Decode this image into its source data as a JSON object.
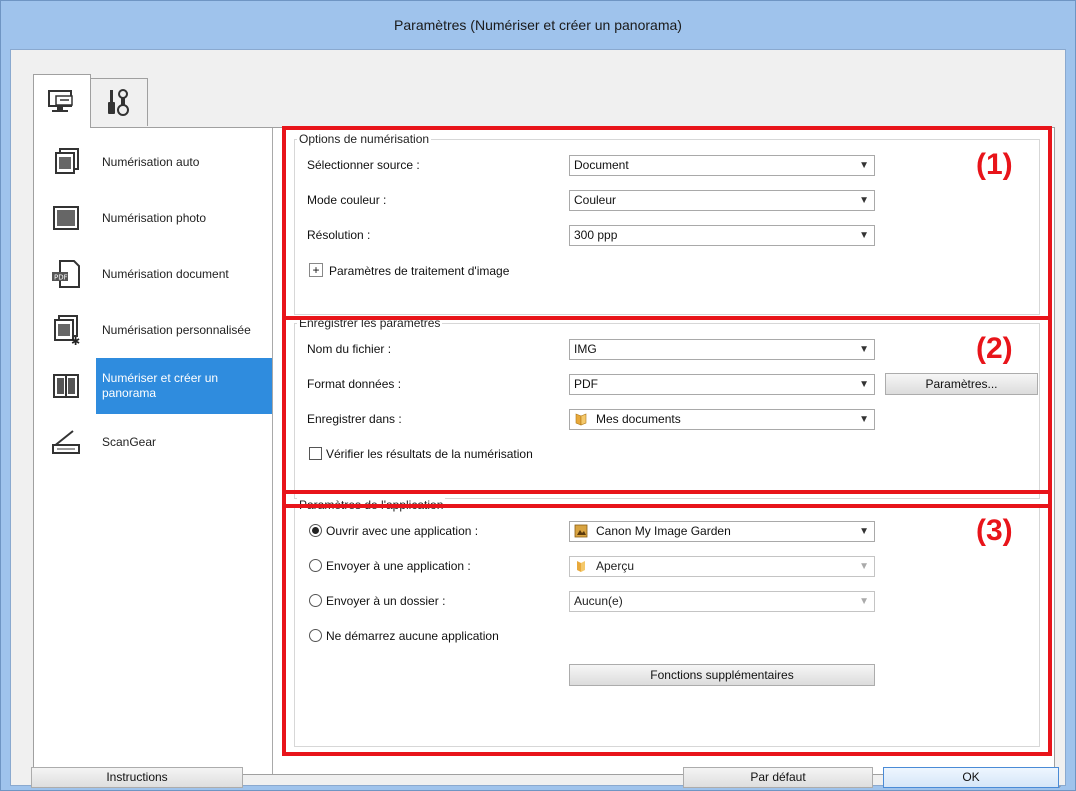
{
  "window": {
    "title": "Paramètres (Numériser et créer un panorama)"
  },
  "tabs": [
    {
      "icon": "scan-computer-icon",
      "selected": true
    },
    {
      "icon": "tools-icon",
      "selected": false
    }
  ],
  "sidebar": {
    "items": [
      {
        "label": "Numérisation auto",
        "icon": "auto-scan-icon"
      },
      {
        "label": "Numérisation photo",
        "icon": "photo-scan-icon"
      },
      {
        "label": "Numérisation document",
        "icon": "document-scan-icon"
      },
      {
        "label": "Numérisation personnalisée",
        "icon": "custom-scan-icon"
      },
      {
        "label": "Numériser et créer un panorama",
        "icon": "panorama-scan-icon",
        "selected": true
      },
      {
        "label": "ScanGear",
        "icon": "scangear-icon"
      }
    ]
  },
  "callouts": {
    "one": "(1)",
    "two": "(2)",
    "three": "(3)"
  },
  "scan_options": {
    "title": "Options de numérisation",
    "source_label": "Sélectionner source :",
    "source_value": "Document",
    "color_label": "Mode couleur :",
    "color_value": "Couleur",
    "resolution_label": "Résolution :",
    "resolution_value": "300 ppp",
    "image_processing_label": "Paramètres de traitement d'image"
  },
  "save_settings": {
    "title": "Enregistrer les paramètres",
    "filename_label": "Nom du fichier :",
    "filename_value": "IMG",
    "format_label": "Format données :",
    "format_value": "PDF",
    "format_settings_button": "Paramètres...",
    "save_in_label": "Enregistrer dans :",
    "save_in_value": "Mes documents",
    "check_results_label": "Vérifier les résultats de la numérisation"
  },
  "app_settings": {
    "title": "Paramètres de l'application",
    "open_with_label": "Ouvrir avec une application :",
    "open_with_value": "Canon My Image Garden",
    "send_app_label": "Envoyer à une application :",
    "send_app_value": "Aperçu",
    "send_folder_label": "Envoyer à un dossier :",
    "send_folder_value": "Aucun(e)",
    "no_app_label": "Ne démarrez aucune application",
    "more_functions_button": "Fonctions supplémentaires"
  },
  "footer": {
    "instructions": "Instructions",
    "defaults": "Par défaut",
    "ok": "OK"
  },
  "colors": {
    "highlight_red": "#e8141a",
    "selection_blue": "#2f8cde",
    "titlebar": "#9fc3ec"
  }
}
